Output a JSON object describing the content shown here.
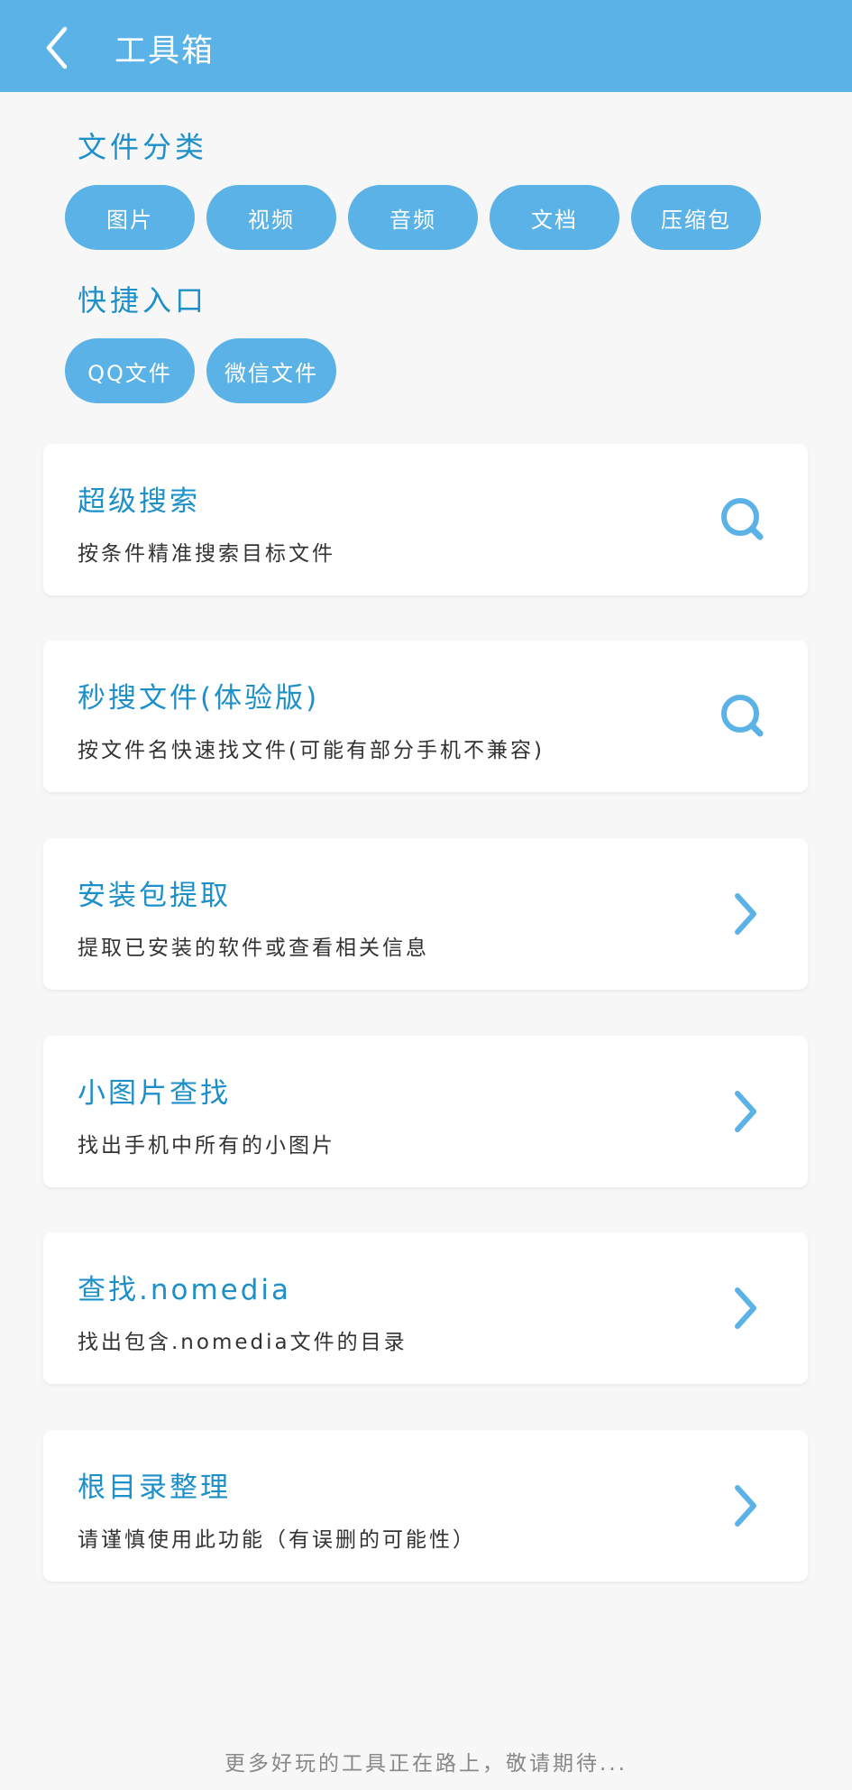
{
  "appbar": {
    "title": "工具箱"
  },
  "file_category": {
    "title": "文件分类",
    "chips": [
      "图片",
      "视频",
      "音频",
      "文档",
      "压缩包"
    ]
  },
  "quick_entry": {
    "title": "快捷入口",
    "chips": [
      "QQ文件",
      "微信文件"
    ]
  },
  "cards": [
    {
      "title": "超级搜索",
      "subtitle": "按条件精准搜索目标文件",
      "icon": "search-icon"
    },
    {
      "title": "秒搜文件(体验版)",
      "subtitle": "按文件名快速找文件(可能有部分手机不兼容)",
      "icon": "search-icon"
    },
    {
      "title": "安装包提取",
      "subtitle": "提取已安装的软件或查看相关信息",
      "icon": "chevron-right-icon"
    },
    {
      "title": "小图片查找",
      "subtitle": "找出手机中所有的小图片",
      "icon": "chevron-right-icon"
    },
    {
      "title": "查找.nomedia",
      "subtitle": "找出包含.nomedia文件的目录",
      "icon": "chevron-right-icon"
    },
    {
      "title": "根目录整理",
      "subtitle": "请谨慎使用此功能（有误删的可能性）",
      "icon": "chevron-right-icon"
    }
  ],
  "footer": {
    "note": "更多好玩的工具正在路上，敬请期待..."
  },
  "colors": {
    "primary": "#5bb2e6",
    "accent_text": "#1d8fc9",
    "background": "#f7f7f7"
  }
}
